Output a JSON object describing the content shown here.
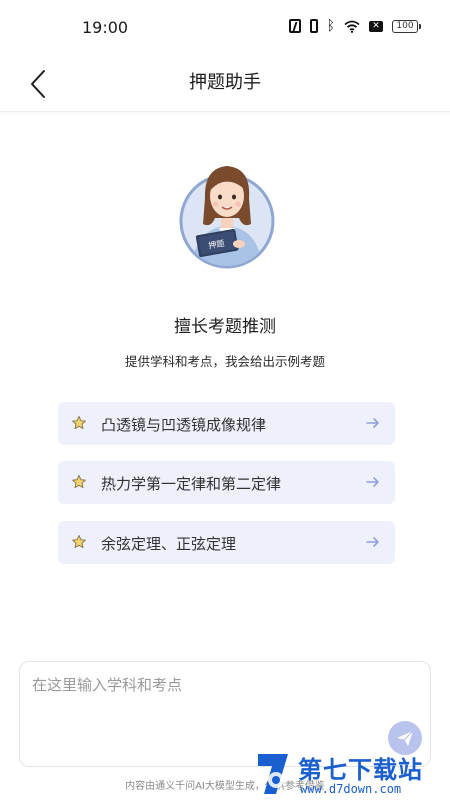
{
  "status_bar": {
    "time": "19:00",
    "battery": "100",
    "icons": [
      "nfc-icon",
      "vibrate-icon",
      "bluetooth-icon",
      "wifi-icon",
      "sim-icon",
      "battery-icon"
    ]
  },
  "header": {
    "title": "押题助手",
    "back_icon": "chevron-left-icon"
  },
  "hero": {
    "avatar_book_label": "押题",
    "title": "擅长考题推测",
    "subtitle": "提供学科和考点，我会给出示例考题"
  },
  "suggestions": [
    {
      "label": "凸透镜与凹透镜成像规律",
      "icon": "star-icon",
      "action_icon": "arrow-right-icon"
    },
    {
      "label": "热力学第一定律和第二定律",
      "icon": "star-icon",
      "action_icon": "arrow-right-icon"
    },
    {
      "label": "余弦定理、正弦定理",
      "icon": "star-icon",
      "action_icon": "arrow-right-icon"
    }
  ],
  "input": {
    "placeholder": "在这里输入学科和考点",
    "value": "",
    "send_icon": "send-icon"
  },
  "footer": {
    "note": "内容由通义千问AI大模型生成，仅供参考借鉴"
  },
  "watermark": {
    "brand": "第七下载站",
    "url": "www.d7down.com"
  },
  "colors": {
    "accent": "#b9c4ee",
    "suggestion_bg": "#eef1fb",
    "star_fill": "#f5d46a",
    "arrow": "#8ea0dd",
    "watermark": "#1a5fcf"
  }
}
